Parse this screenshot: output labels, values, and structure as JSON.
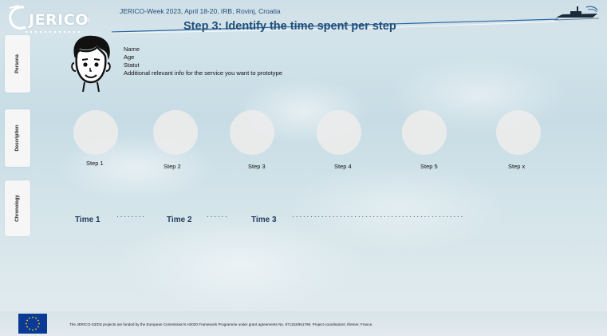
{
  "header": {
    "logo_text": "JERICO",
    "logo_suffix": "RI",
    "event": "JERICO-Week 2023, April 18-20, IRB, Rovinj, Croatia",
    "title": "Step 3: Identify the time spent per step"
  },
  "sidebar": {
    "tabs": [
      {
        "label": "Persona"
      },
      {
        "label": "Description"
      },
      {
        "label": "Chronology"
      }
    ]
  },
  "persona": {
    "icon": "boy-face-icon",
    "lines": [
      "Name",
      "Age",
      "Statut",
      "Additional relevant info for the service you want to prototype"
    ]
  },
  "steps": [
    "Step 1",
    "Step 2",
    "Step 3",
    "Step  4",
    "Step  5",
    "Step  x"
  ],
  "chronology": {
    "times": [
      "Time  1",
      "Time 2",
      "Time 3"
    ],
    "dots": [
      "········",
      "······",
      "···············································"
    ]
  },
  "footer": {
    "text": "The JERICO-S3/DS projects are funded by the European Commission's H2020 Framework Programme under grant agreements No. 871153/951799. Project coordinators: Ifremer, France.",
    "flag_icon": "eu-flag-icon"
  },
  "colors": {
    "title": "#1f4e79",
    "eu_blue": "#0b3a96",
    "eu_star": "#ffd700"
  }
}
